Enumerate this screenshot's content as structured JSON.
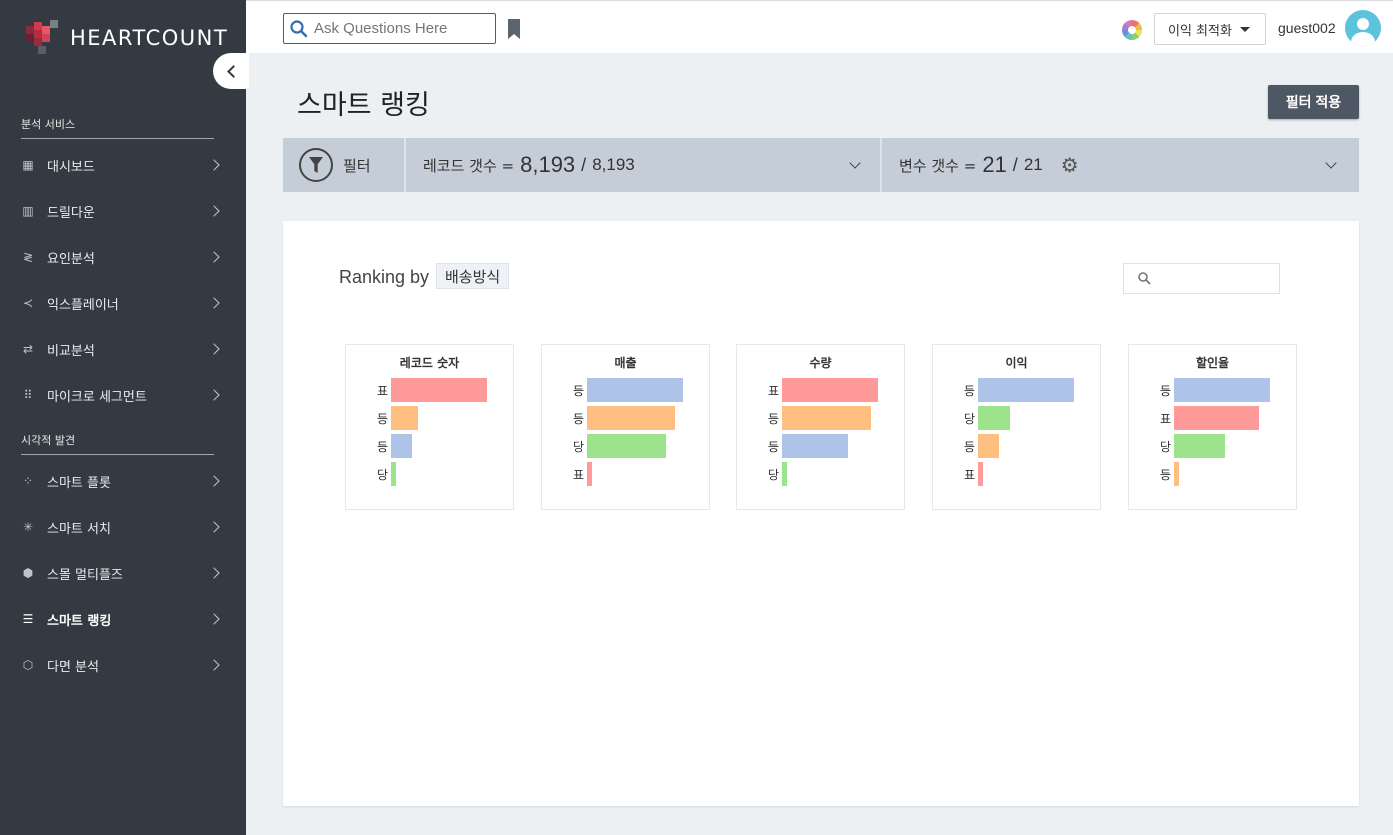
{
  "app": {
    "logo_text": "HEARTCOUNT"
  },
  "sidebar": {
    "sections": [
      {
        "title": "분석 서비스",
        "items": [
          {
            "label": "대시보드",
            "icon": "dashboard-icon"
          },
          {
            "label": "드릴다운",
            "icon": "drilldown-icon"
          },
          {
            "label": "요인분석",
            "icon": "factor-icon"
          },
          {
            "label": "익스플레이너",
            "icon": "share-icon"
          },
          {
            "label": "비교분석",
            "icon": "compare-icon"
          },
          {
            "label": "마이크로 세그먼트",
            "icon": "grid-icon"
          }
        ]
      },
      {
        "title": "시각적 발견",
        "items": [
          {
            "label": "스마트 플롯",
            "icon": "scatter-icon"
          },
          {
            "label": "스마트 서치",
            "icon": "network-icon"
          },
          {
            "label": "스몰 멀티플즈",
            "icon": "cube-icon"
          },
          {
            "label": "스마트 랭킹",
            "icon": "ranking-icon",
            "active": true
          },
          {
            "label": "다면 분석",
            "icon": "hexagon-icon"
          }
        ]
      }
    ]
  },
  "topbar": {
    "search_placeholder": "Ask Questions Here",
    "dropdown_value": "이익 최적화",
    "username": "guest002"
  },
  "page": {
    "title": "스마트 랭킹",
    "apply_button": "필터 적용"
  },
  "filterbar": {
    "filter_label": "필터",
    "records_label": "레코드 갯수 =",
    "records_value": "8,193",
    "records_total": "8,193",
    "vars_label": "변수 갯수 =",
    "vars_value": "21",
    "vars_total": "21"
  },
  "ranking": {
    "label": "Ranking by",
    "tag": "배송방식"
  },
  "colors": {
    "red": "#ff9a9a",
    "orange": "#ffbf80",
    "blue": "#adc4e8",
    "green": "#9de38e"
  },
  "chart_data": {
    "type": "bar",
    "charts": [
      {
        "title": "레코드 숫자",
        "bars": [
          {
            "label": "표",
            "value": 1.0,
            "color": "red"
          },
          {
            "label": "등",
            "value": 0.28,
            "color": "orange"
          },
          {
            "label": "등",
            "value": 0.22,
            "color": "blue"
          },
          {
            "label": "당",
            "value": 0.05,
            "color": "green"
          }
        ]
      },
      {
        "title": "매출",
        "bars": [
          {
            "label": "등",
            "value": 1.0,
            "color": "blue"
          },
          {
            "label": "등",
            "value": 0.92,
            "color": "orange"
          },
          {
            "label": "당",
            "value": 0.82,
            "color": "green"
          },
          {
            "label": "표",
            "value": 0.05,
            "color": "red"
          }
        ]
      },
      {
        "title": "수량",
        "bars": [
          {
            "label": "표",
            "value": 1.0,
            "color": "red"
          },
          {
            "label": "등",
            "value": 0.93,
            "color": "orange"
          },
          {
            "label": "등",
            "value": 0.69,
            "color": "blue"
          },
          {
            "label": "당",
            "value": 0.05,
            "color": "green"
          }
        ]
      },
      {
        "title": "이익",
        "bars": [
          {
            "label": "등",
            "value": 1.0,
            "color": "blue"
          },
          {
            "label": "당",
            "value": 0.33,
            "color": "green"
          },
          {
            "label": "등",
            "value": 0.22,
            "color": "orange"
          },
          {
            "label": "표",
            "value": 0.05,
            "color": "red"
          }
        ]
      },
      {
        "title": "할인율",
        "bars": [
          {
            "label": "등",
            "value": 1.0,
            "color": "blue"
          },
          {
            "label": "표",
            "value": 0.89,
            "color": "red"
          },
          {
            "label": "당",
            "value": 0.53,
            "color": "green"
          },
          {
            "label": "등",
            "value": 0.05,
            "color": "orange"
          }
        ]
      }
    ]
  }
}
